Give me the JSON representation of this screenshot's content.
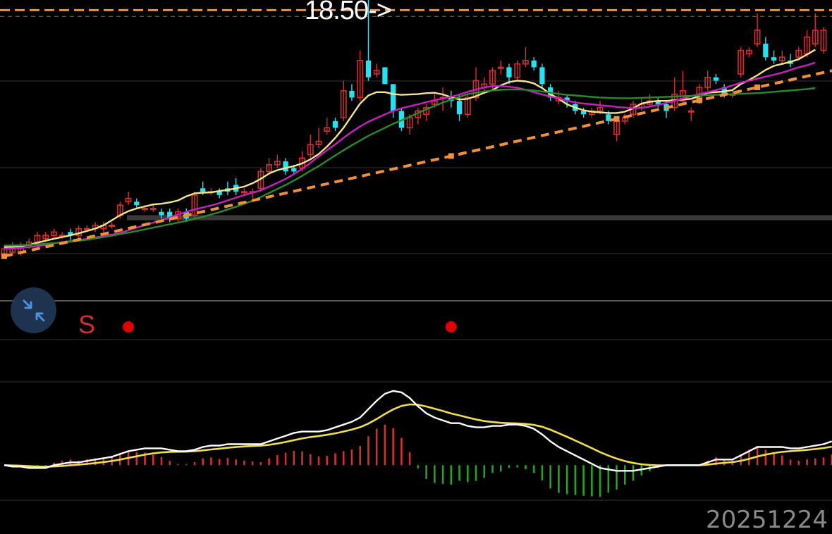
{
  "price_marker": {
    "label": "18.50->"
  },
  "date_label": "20251224",
  "signal_label": "S",
  "icons": {
    "collapse": "collapse-arrows-icon"
  },
  "colors": {
    "up": "#d32f2f",
    "down": "#29e0f0",
    "ma_short": "#f6e58a",
    "ma_mid": "#c81fc3",
    "ma_long": "#2a8a2a",
    "trendline": "#f0903a",
    "dif": "#ffffff",
    "dea": "#f2dd4a",
    "macd_pos": "#d32f2f",
    "macd_neg": "#1fa51f",
    "signal_dot": "#e00000",
    "grid": "#333333"
  },
  "chart_data": [
    {
      "type": "candlestick",
      "ylim": [
        10.0,
        18.8
      ],
      "y_reference": 18.5,
      "candles": [
        [
          11.2,
          11.4,
          11.5,
          11.1
        ],
        [
          11.3,
          11.4,
          11.6,
          11.2
        ],
        [
          11.3,
          11.5,
          11.6,
          11.2
        ],
        [
          11.5,
          11.6,
          11.7,
          11.4
        ],
        [
          11.6,
          11.8,
          11.9,
          11.5
        ],
        [
          11.7,
          11.8,
          11.9,
          11.6
        ],
        [
          11.8,
          11.9,
          12.0,
          11.7
        ],
        [
          11.8,
          11.8,
          11.9,
          11.7
        ],
        [
          11.9,
          11.8,
          12.0,
          11.6
        ],
        [
          11.8,
          12.0,
          12.1,
          11.7
        ],
        [
          12.0,
          12.0,
          12.1,
          11.9
        ],
        [
          12.0,
          12.1,
          12.2,
          11.9
        ],
        [
          12.0,
          12.1,
          12.2,
          11.9
        ],
        [
          12.1,
          12.1,
          12.2,
          12.0
        ],
        [
          12.4,
          12.7,
          12.8,
          12.3
        ],
        [
          12.8,
          12.9,
          13.1,
          12.7
        ],
        [
          12.8,
          12.7,
          12.9,
          12.6
        ],
        [
          12.6,
          12.6,
          12.7,
          12.5
        ],
        [
          12.6,
          12.6,
          12.7,
          12.5
        ],
        [
          12.5,
          12.4,
          12.6,
          12.3
        ],
        [
          12.5,
          12.3,
          12.6,
          12.2
        ],
        [
          12.3,
          12.5,
          12.6,
          12.2
        ],
        [
          12.5,
          12.3,
          12.6,
          12.2
        ],
        [
          12.4,
          13.0,
          13.1,
          12.3
        ],
        [
          13.2,
          13.1,
          13.4,
          13.0
        ],
        [
          13.1,
          13.1,
          13.2,
          13.0
        ],
        [
          13.1,
          13.0,
          13.2,
          12.9
        ],
        [
          13.2,
          13.1,
          13.4,
          13.0
        ],
        [
          13.3,
          13.1,
          13.5,
          13.0
        ],
        [
          13.1,
          13.1,
          13.2,
          13.0
        ],
        [
          13.1,
          13.1,
          13.2,
          12.9
        ],
        [
          13.2,
          13.7,
          13.8,
          13.1
        ],
        [
          13.7,
          13.9,
          14.1,
          13.6
        ],
        [
          13.9,
          14.0,
          14.2,
          13.8
        ],
        [
          14.0,
          13.7,
          14.1,
          13.6
        ],
        [
          13.8,
          13.7,
          13.9,
          13.6
        ],
        [
          13.8,
          14.1,
          14.3,
          13.7
        ],
        [
          14.2,
          14.5,
          14.8,
          14.1
        ],
        [
          14.5,
          14.6,
          15.0,
          14.4
        ],
        [
          14.9,
          15.0,
          15.3,
          14.8
        ],
        [
          15.2,
          15.0,
          15.3,
          14.9
        ],
        [
          15.3,
          16.1,
          16.4,
          15.2
        ],
        [
          16.1,
          15.9,
          16.3,
          15.8
        ],
        [
          15.9,
          17.0,
          17.3,
          15.8
        ],
        [
          17.0,
          16.5,
          18.8,
          16.4
        ],
        [
          16.6,
          16.7,
          16.9,
          16.5
        ],
        [
          16.8,
          16.3,
          16.8,
          16.3
        ],
        [
          16.3,
          15.5,
          16.3,
          15.3
        ],
        [
          15.5,
          15.0,
          15.6,
          14.9
        ],
        [
          15.0,
          15.3,
          15.4,
          14.8
        ],
        [
          15.3,
          15.5,
          15.6,
          15.1
        ],
        [
          15.4,
          15.6,
          15.7,
          15.2
        ],
        [
          15.7,
          15.8,
          16.0,
          15.6
        ],
        [
          15.9,
          15.9,
          16.2,
          15.5
        ],
        [
          15.9,
          15.8,
          16.1,
          15.6
        ],
        [
          15.8,
          15.4,
          16.0,
          15.2
        ],
        [
          15.4,
          15.9,
          16.0,
          15.3
        ],
        [
          15.9,
          16.4,
          16.8,
          15.8
        ],
        [
          16.2,
          16.3,
          16.5,
          16.1
        ],
        [
          16.3,
          16.7,
          16.8,
          16.1
        ],
        [
          16.8,
          16.8,
          17.0,
          16.6
        ],
        [
          16.8,
          16.5,
          16.9,
          16.3
        ],
        [
          16.5,
          16.9,
          17.0,
          16.4
        ],
        [
          16.9,
          17.0,
          17.4,
          16.8
        ],
        [
          17.0,
          16.8,
          17.1,
          16.7
        ],
        [
          16.8,
          16.3,
          16.9,
          16.2
        ],
        [
          16.2,
          15.9,
          16.3,
          15.8
        ],
        [
          15.8,
          15.9,
          16.1,
          15.7
        ],
        [
          15.9,
          15.8,
          16.0,
          15.6
        ],
        [
          15.7,
          15.5,
          15.8,
          15.4
        ],
        [
          15.5,
          15.4,
          15.6,
          15.3
        ],
        [
          15.4,
          15.5,
          15.6,
          15.3
        ],
        [
          15.5,
          15.6,
          15.8,
          15.4
        ],
        [
          15.4,
          15.2,
          15.5,
          15.1
        ],
        [
          14.8,
          15.2,
          15.3,
          14.6
        ],
        [
          15.2,
          15.3,
          15.4,
          15.1
        ],
        [
          15.4,
          15.7,
          15.8,
          15.3
        ],
        [
          15.6,
          15.7,
          15.9,
          15.5
        ],
        [
          15.7,
          15.8,
          16.0,
          15.6
        ],
        [
          15.8,
          15.7,
          15.9,
          15.6
        ],
        [
          15.7,
          15.5,
          15.8,
          15.3
        ],
        [
          15.6,
          16.0,
          16.5,
          15.5
        ],
        [
          15.8,
          16.1,
          16.7,
          15.7
        ],
        [
          15.5,
          15.5,
          15.6,
          15.2
        ],
        [
          15.8,
          16.2,
          16.3,
          15.7
        ],
        [
          16.2,
          16.5,
          16.7,
          16.1
        ],
        [
          16.5,
          16.4,
          16.6,
          16.3
        ],
        [
          16.2,
          16.0,
          16.3,
          15.9
        ],
        [
          16.0,
          16.0,
          16.1,
          15.9
        ],
        [
          16.6,
          17.3,
          17.4,
          16.5
        ],
        [
          17.2,
          17.3,
          17.4,
          17.1
        ],
        [
          17.5,
          17.9,
          18.4,
          17.4
        ],
        [
          17.5,
          17.1,
          17.7,
          17.0
        ],
        [
          17.1,
          17.0,
          17.3,
          16.9
        ],
        [
          17.0,
          17.1,
          17.3,
          16.9
        ],
        [
          17.0,
          16.9,
          17.2,
          16.8
        ],
        [
          17.1,
          17.3,
          17.4,
          17.0
        ],
        [
          17.2,
          17.7,
          17.9,
          17.1
        ],
        [
          17.5,
          17.9,
          18.4,
          17.4
        ],
        [
          17.3,
          17.9,
          18.0,
          17.2
        ]
      ],
      "ma": [
        {
          "key": "ma_short",
          "values": [
            11.45,
            11.46,
            11.48,
            11.52,
            11.58,
            11.64,
            11.7,
            11.75,
            11.8,
            11.86,
            11.93,
            12.0,
            12.1,
            12.25,
            12.4,
            12.52,
            12.6,
            12.66,
            12.72,
            12.74,
            12.78,
            12.84,
            12.96,
            13.05,
            13.07,
            13.08,
            13.12,
            13.15,
            13.2,
            13.25,
            13.35,
            13.48,
            13.64,
            13.74,
            13.8,
            13.86,
            13.94,
            14.06,
            14.22,
            14.44,
            14.7,
            15.0,
            15.36,
            15.72,
            15.96,
            16.06,
            16.06,
            16.0,
            15.98,
            15.99,
            16.0,
            16.03,
            16.04,
            15.99,
            15.91,
            15.84,
            15.86,
            15.94,
            16.04,
            16.12,
            16.26,
            16.36,
            16.4,
            16.38,
            16.32,
            16.18,
            16.0,
            15.86,
            15.7,
            15.6,
            15.52,
            15.48,
            15.46,
            15.44,
            15.44,
            15.48,
            15.58,
            15.72,
            15.77,
            15.8,
            15.8,
            15.82,
            15.84,
            15.86,
            15.94,
            16.04,
            16.06,
            16.08,
            16.12,
            16.3,
            16.42,
            16.56,
            16.72,
            16.84,
            16.9,
            16.96,
            17.04,
            17.18,
            17.32
          ]
        },
        {
          "key": "ma_mid",
          "values": [
            11.4,
            11.41,
            11.43,
            11.45,
            11.48,
            11.52,
            11.56,
            11.6,
            11.63,
            11.66,
            11.7,
            11.74,
            11.78,
            11.82,
            11.87,
            11.95,
            12.03,
            12.11,
            12.18,
            12.25,
            12.33,
            12.42,
            12.5,
            12.57,
            12.63,
            12.69,
            12.76,
            12.84,
            12.92,
            13.0,
            13.07,
            13.14,
            13.25,
            13.36,
            13.48,
            13.62,
            13.78,
            13.96,
            14.15,
            14.33,
            14.51,
            14.7,
            14.88,
            15.04,
            15.18,
            15.29,
            15.4,
            15.5,
            15.58,
            15.64,
            15.7,
            15.76,
            15.82,
            15.87,
            15.92,
            15.99,
            16.07,
            16.14,
            16.2,
            16.24,
            16.24,
            16.22,
            16.19,
            16.13,
            16.06,
            15.99,
            15.93,
            15.87,
            15.81,
            15.75,
            15.72,
            15.7,
            15.67,
            15.65,
            15.62,
            15.6,
            15.58,
            15.59,
            15.63,
            15.68,
            15.74,
            15.8,
            15.87,
            15.94,
            16.0,
            16.06,
            16.12,
            16.18,
            16.26,
            16.34,
            16.4,
            16.46,
            16.52,
            16.58,
            16.64,
            16.72,
            16.8,
            16.86,
            16.94
          ]
        },
        {
          "key": "ma_long",
          "values": [
            11.5,
            11.5,
            11.51,
            11.52,
            11.53,
            11.55,
            11.57,
            11.59,
            11.61,
            11.64,
            11.67,
            11.71,
            11.75,
            11.79,
            11.84,
            11.88,
            11.93,
            11.98,
            12.03,
            12.08,
            12.13,
            12.18,
            12.23,
            12.29,
            12.35,
            12.42,
            12.49,
            12.57,
            12.65,
            12.74,
            12.83,
            12.94,
            13.06,
            13.18,
            13.3,
            13.43,
            13.57,
            13.72,
            13.86,
            14.02,
            14.18,
            14.33,
            14.48,
            14.62,
            14.76,
            14.88,
            15.0,
            15.12,
            15.22,
            15.33,
            15.44,
            15.55,
            15.65,
            15.75,
            15.84,
            15.92,
            16.0,
            16.04,
            16.08,
            16.11,
            16.13,
            16.14,
            16.14,
            16.13,
            16.11,
            16.08,
            16.04,
            16.01,
            15.98,
            15.96,
            15.94,
            15.92,
            15.9,
            15.89,
            15.88,
            15.88,
            15.88,
            15.89,
            15.9,
            15.91,
            15.92,
            15.93,
            15.94,
            15.95,
            15.96,
            15.97,
            15.98,
            15.99,
            16.0,
            16.01,
            16.02,
            16.03,
            16.05,
            16.07,
            16.09,
            16.11,
            16.13,
            16.15,
            16.18
          ]
        }
      ],
      "trendline": [
        [
          0,
          11.18
        ],
        [
          100,
          16.7
        ]
      ],
      "trendline_nodes": [
        0,
        54,
        74,
        84,
        91
      ],
      "resistance": 18.5,
      "support_band": [
        12.25,
        12.4
      ]
    },
    {
      "type": "signal",
      "dots": [
        15,
        54
      ]
    },
    {
      "type": "macd",
      "ylim": [
        -0.25,
        0.58
      ],
      "dif": [
        0.0,
        -0.01,
        -0.01,
        -0.02,
        -0.02,
        -0.02,
        0.0,
        0.01,
        0.02,
        0.02,
        0.03,
        0.04,
        0.05,
        0.06,
        0.08,
        0.1,
        0.11,
        0.12,
        0.12,
        0.12,
        0.11,
        0.1,
        0.1,
        0.11,
        0.13,
        0.14,
        0.14,
        0.15,
        0.15,
        0.15,
        0.15,
        0.15,
        0.17,
        0.19,
        0.21,
        0.23,
        0.24,
        0.24,
        0.24,
        0.25,
        0.27,
        0.29,
        0.31,
        0.34,
        0.4,
        0.46,
        0.51,
        0.53,
        0.52,
        0.48,
        0.42,
        0.37,
        0.34,
        0.32,
        0.3,
        0.3,
        0.28,
        0.27,
        0.27,
        0.28,
        0.28,
        0.29,
        0.29,
        0.28,
        0.26,
        0.22,
        0.17,
        0.13,
        0.1,
        0.07,
        0.04,
        0.01,
        -0.02,
        -0.03,
        -0.04,
        -0.04,
        -0.04,
        -0.03,
        -0.02,
        -0.01,
        0.0,
        0.0,
        0.0,
        0.0,
        0.0,
        0.02,
        0.04,
        0.04,
        0.04,
        0.07,
        0.1,
        0.13,
        0.13,
        0.13,
        0.13,
        0.12,
        0.12,
        0.13,
        0.14,
        0.15,
        0.17
      ]
    }
  ]
}
